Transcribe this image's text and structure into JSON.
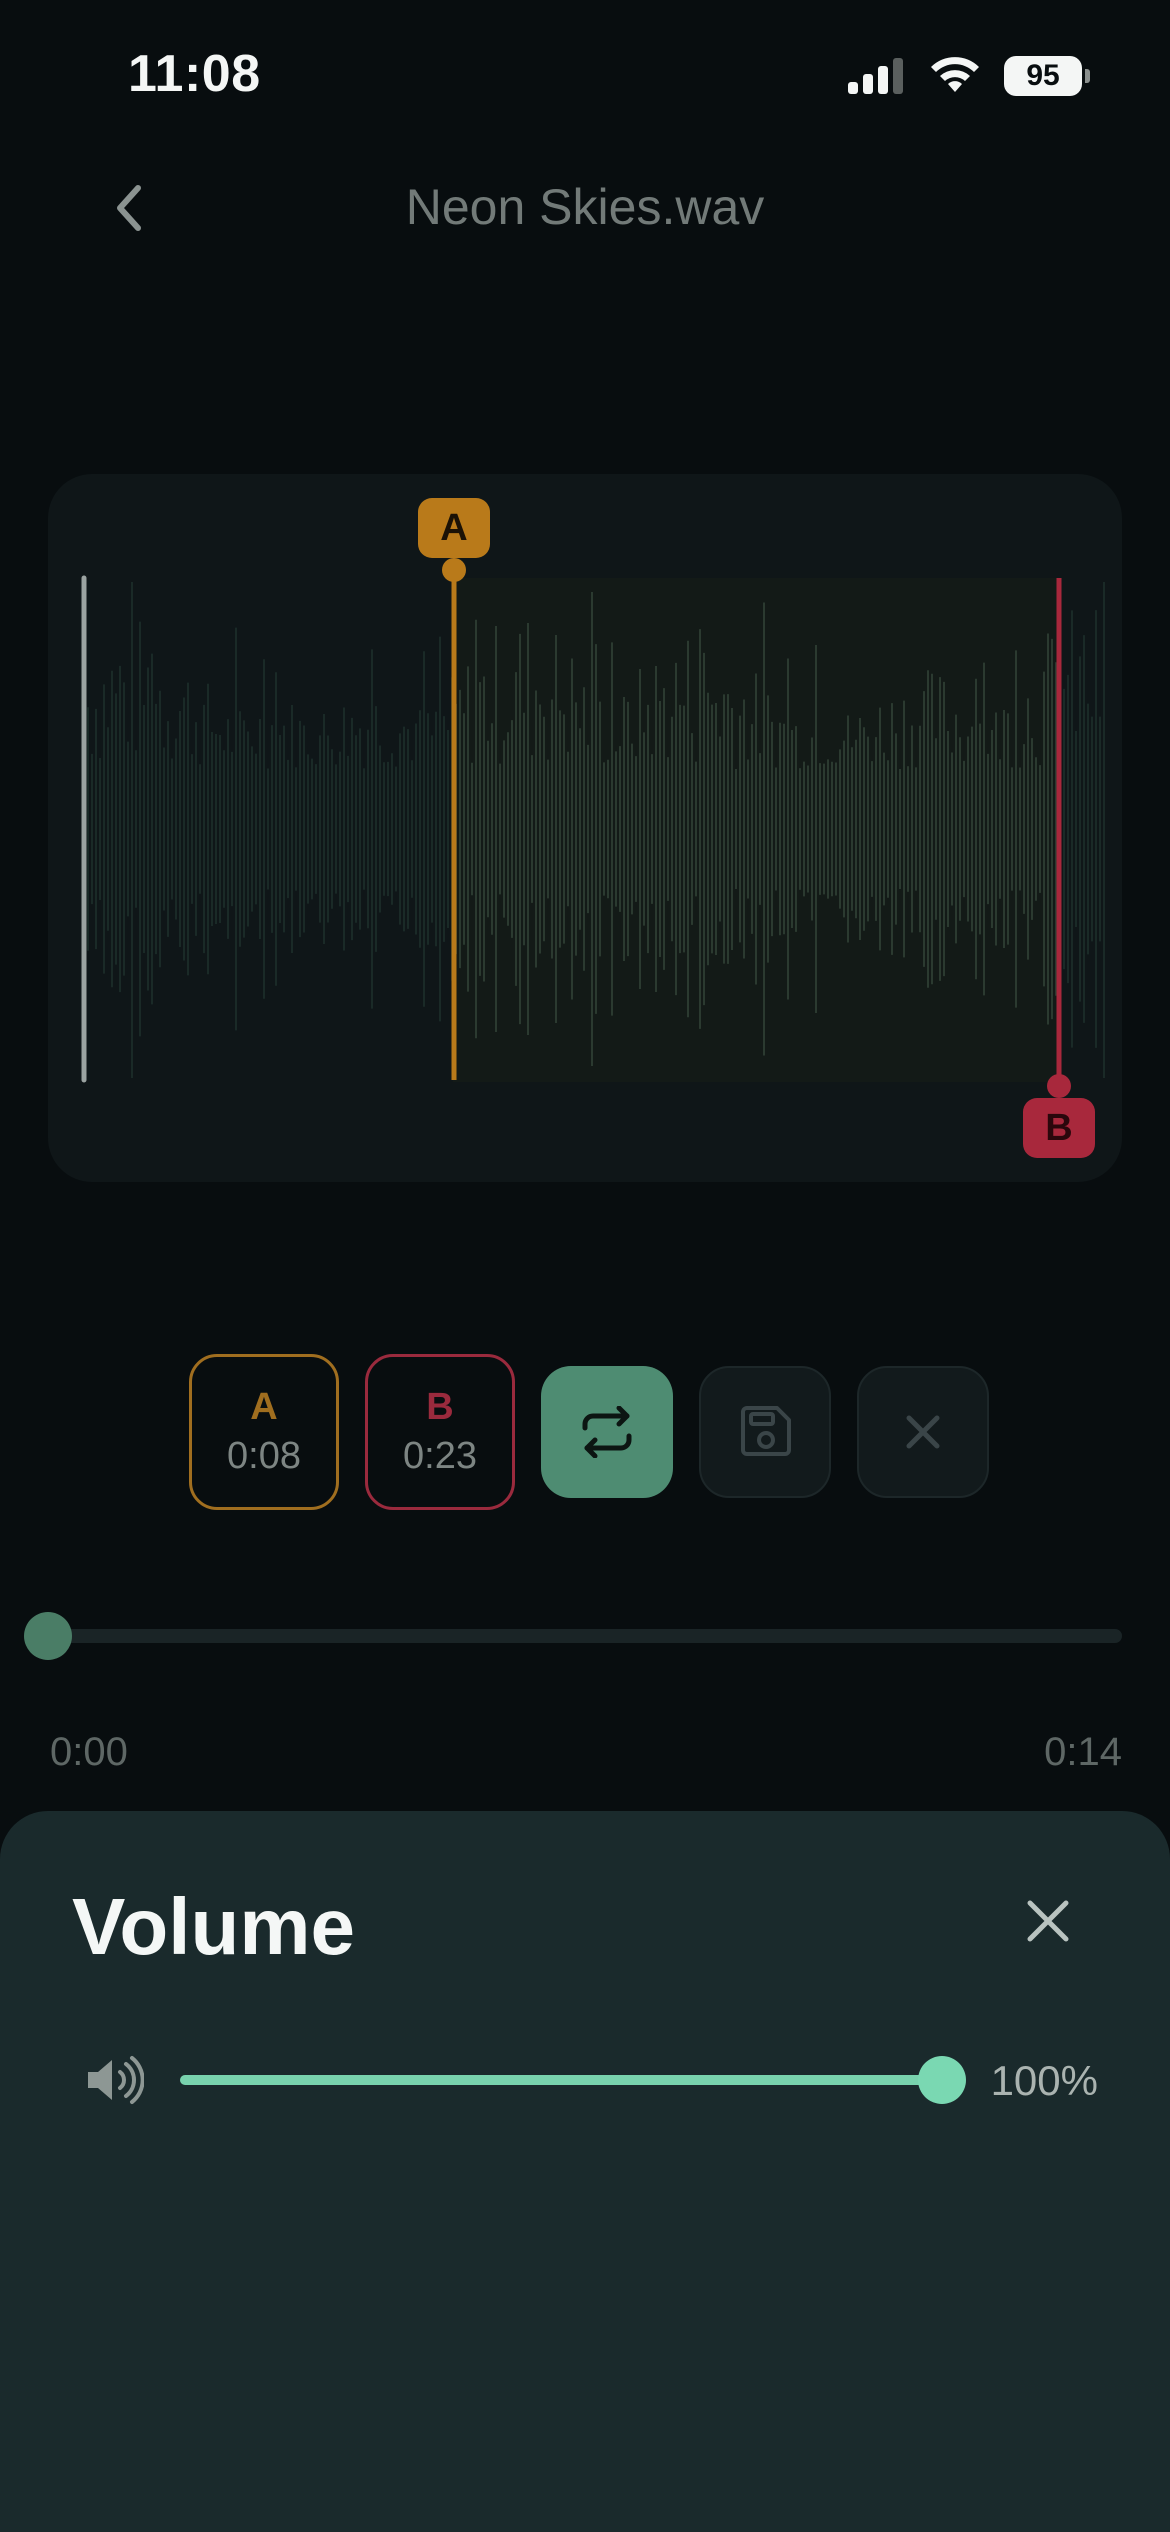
{
  "status": {
    "time": "11:08",
    "battery": "95"
  },
  "header": {
    "title": "Neon Skies.wav"
  },
  "waveform": {
    "marker_a_label": "A",
    "marker_b_label": "B"
  },
  "controls": {
    "point_a": {
      "letter": "A",
      "time": "0:08"
    },
    "point_b": {
      "letter": "B",
      "time": "0:23"
    },
    "loop_icon": "repeat-icon",
    "save_icon": "floppy-disk-icon",
    "clear_icon": "close-icon"
  },
  "playback": {
    "current": "0:00",
    "total": "0:14",
    "progress_fraction": 0.0
  },
  "volume_sheet": {
    "title": "Volume",
    "value_text": "100%",
    "level_fraction": 1.0,
    "speaker_icon": "speaker-icon",
    "close_icon": "close-icon"
  },
  "colors": {
    "accent_green": "#78d2ad",
    "marker_a": "#b97a1a",
    "marker_b": "#a8283c",
    "sheet_bg": "#1a2a2c"
  }
}
